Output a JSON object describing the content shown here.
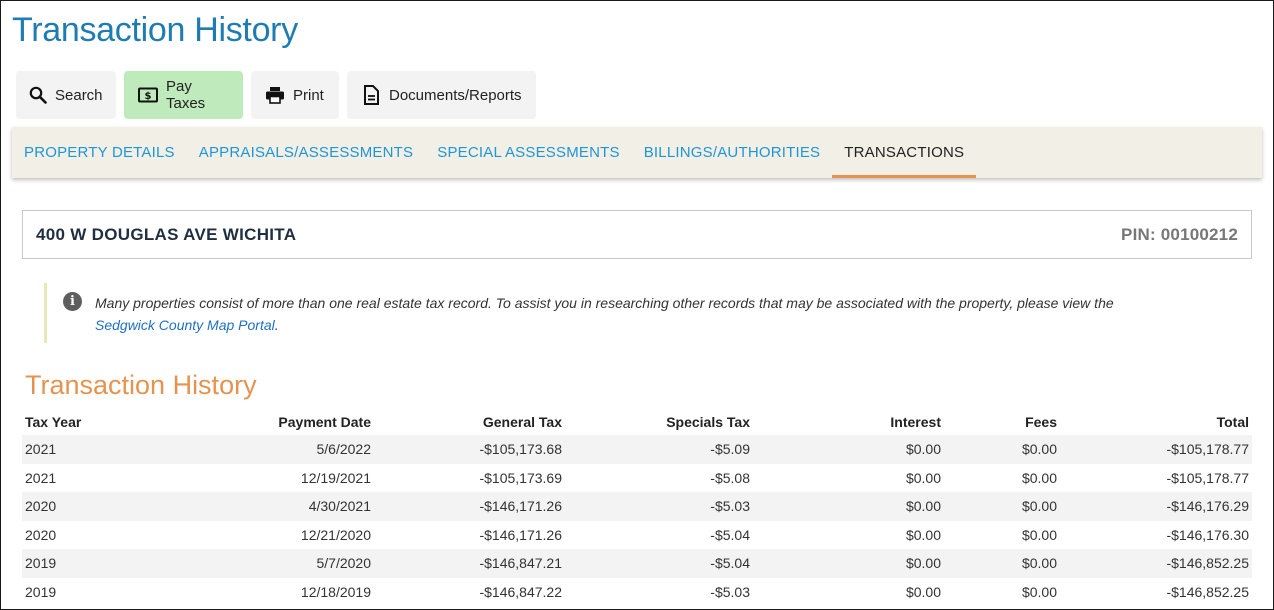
{
  "page": {
    "title": "Transaction History"
  },
  "toolbar": {
    "search_label": "Search",
    "pay_label": "Pay Taxes",
    "print_label": "Print",
    "docs_label": "Documents/Reports"
  },
  "tabs": [
    {
      "label": "PROPERTY DETAILS"
    },
    {
      "label": "APPRAISALS/ASSESSMENTS"
    },
    {
      "label": "SPECIAL ASSESSMENTS"
    },
    {
      "label": "BILLINGS/AUTHORITIES"
    },
    {
      "label": "TRANSACTIONS",
      "active": true
    }
  ],
  "property": {
    "address": "400 W DOUGLAS AVE WICHITA",
    "pin": "PIN: 00100212"
  },
  "notice": {
    "text": "Many properties consist of more than one real estate tax record. To assist you in researching other records that may be associated with the property, please view the",
    "link_text": "Sedgwick County Map Portal",
    "suffix": "."
  },
  "history": {
    "title": "Transaction History",
    "columns": [
      "Tax Year",
      "Payment Date",
      "General Tax",
      "Specials Tax",
      "Interest",
      "Fees",
      "Total"
    ],
    "rows": [
      [
        "2021",
        "5/6/2022",
        "-$105,173.68",
        "-$5.09",
        "$0.00",
        "$0.00",
        "-$105,178.77"
      ],
      [
        "2021",
        "12/19/2021",
        "-$105,173.69",
        "-$5.08",
        "$0.00",
        "$0.00",
        "-$105,178.77"
      ],
      [
        "2020",
        "4/30/2021",
        "-$146,171.26",
        "-$5.03",
        "$0.00",
        "$0.00",
        "-$146,176.29"
      ],
      [
        "2020",
        "12/21/2020",
        "-$146,171.26",
        "-$5.04",
        "$0.00",
        "$0.00",
        "-$146,176.30"
      ],
      [
        "2019",
        "5/7/2020",
        "-$146,847.21",
        "-$5.04",
        "$0.00",
        "$0.00",
        "-$146,852.25"
      ],
      [
        "2019",
        "12/18/2019",
        "-$146,847.22",
        "-$5.03",
        "$0.00",
        "$0.00",
        "-$146,852.25"
      ]
    ]
  },
  "colors": {
    "title_blue": "#1f7cb3",
    "tab_blue": "#1f96d6",
    "accent_orange": "#e6934f",
    "pay_green": "#bfeabb",
    "link_blue": "#1f6fc4"
  },
  "icons": {
    "search": "search-icon",
    "pay": "dollar-bill-icon",
    "print": "printer-icon",
    "docs": "document-icon",
    "info": "info-icon"
  }
}
